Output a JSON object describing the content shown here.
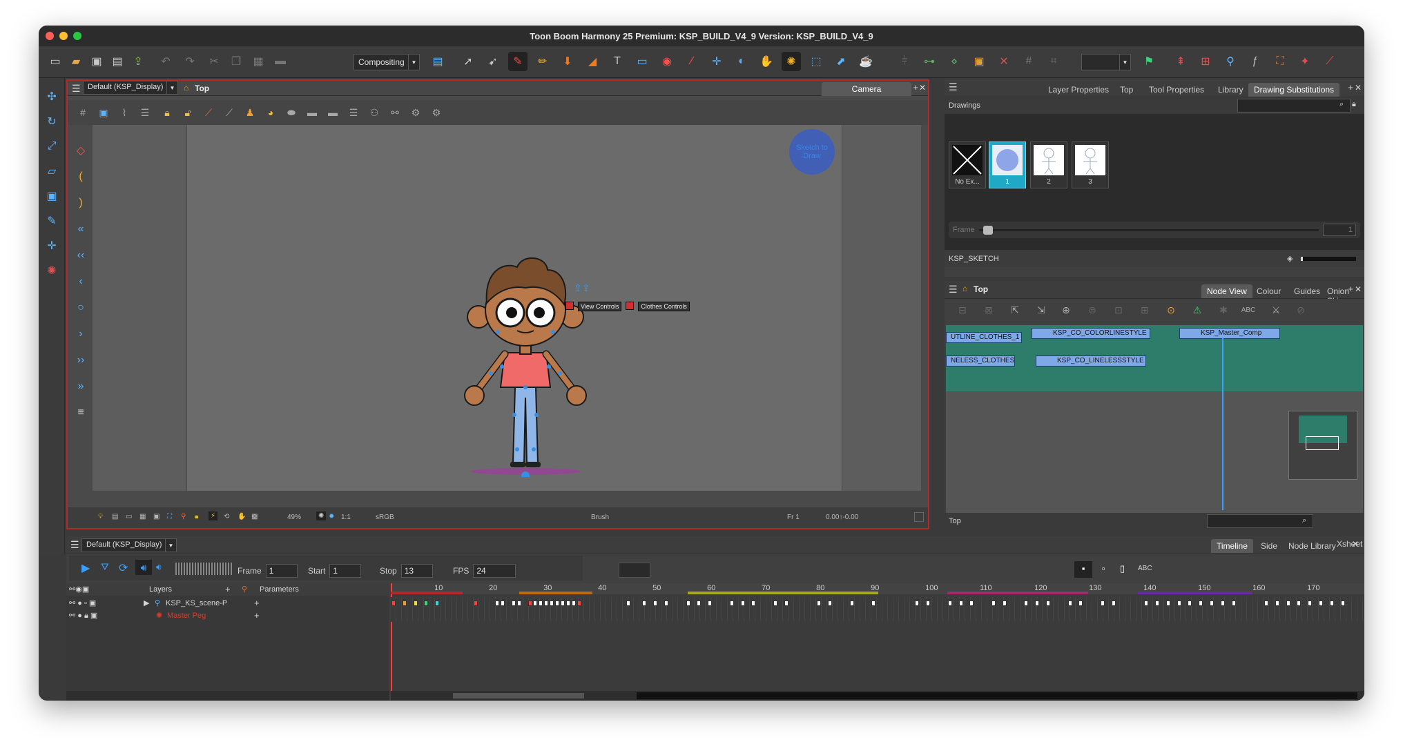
{
  "window": {
    "title": "Toon Boom Harmony 25 Premium: KSP_BUILD_V4_9 Version: KSP_BUILD_V4_9"
  },
  "colors": {
    "accent": "#3aa0ff",
    "selection": "#1fa9c7",
    "red_border": "#b32a2a",
    "timeline_teal": "#2e7d6b"
  },
  "toolbar": {
    "workspace": "Compositing"
  },
  "camera_view": {
    "layout": "Default (KSP_Display)",
    "breadcrumb": "Top",
    "tab": "Camera",
    "status_zoom": "49%",
    "status_ratio": "1:1",
    "status_color": "sRGB",
    "status_tool": "Brush",
    "status_frame": "Fr 1",
    "status_coords": "0.00↑-0.00",
    "badge_text": "Sketch to Draw",
    "controls": [
      "View Controls",
      "Clothes Controls"
    ]
  },
  "drawings_panel": {
    "tabs": [
      "Layer Properties",
      "Top",
      "Tool Properties",
      "Library",
      "Drawing Substitutions"
    ],
    "active_tab": "Drawing Substitutions",
    "section": "Drawings",
    "items": [
      {
        "label": "No Ex...",
        "selected": false
      },
      {
        "label": "1",
        "selected": true
      },
      {
        "label": "2",
        "selected": false
      },
      {
        "label": "3",
        "selected": false
      }
    ],
    "frame_label": "Frame",
    "frame_value": "1",
    "layer_name": "KSP_SKETCH"
  },
  "node_view": {
    "breadcrumb": "Top",
    "tabs": [
      "Node View",
      "Colour",
      "Guides",
      "Onion Skin"
    ],
    "active_tab": "Node View",
    "nodes": [
      "UTLINE_CLOTHES_1",
      "KSP_CO_COLORLINESTYLE",
      "KSP_Master_Comp",
      "NELESS_CLOTHES",
      "KSP_CO_LINELESSSTYLE"
    ],
    "footer": "Top"
  },
  "timeline": {
    "layout": "Default (KSP_Display)",
    "tabs": [
      "Timeline",
      "Side",
      "Node Library",
      "Xsheet"
    ],
    "active_tab": "Timeline",
    "frame_label": "Frame",
    "frame_value": "1",
    "start_label": "Start",
    "start_value": "1",
    "stop_label": "Stop",
    "stop_value": "13",
    "fps_label": "FPS",
    "fps_value": "24",
    "layers_header": "Layers",
    "parameters_header": "Parameters",
    "layers": [
      {
        "name": "KSP_KS_scene-P",
        "color": "#e0e0e0"
      },
      {
        "name": "Master Peg",
        "color": "#e03a2a"
      }
    ],
    "ticks": [
      "10",
      "20",
      "30",
      "40",
      "50",
      "60",
      "70",
      "80",
      "90",
      "100",
      "110",
      "120",
      "130",
      "140",
      "150",
      "160",
      "170"
    ]
  }
}
